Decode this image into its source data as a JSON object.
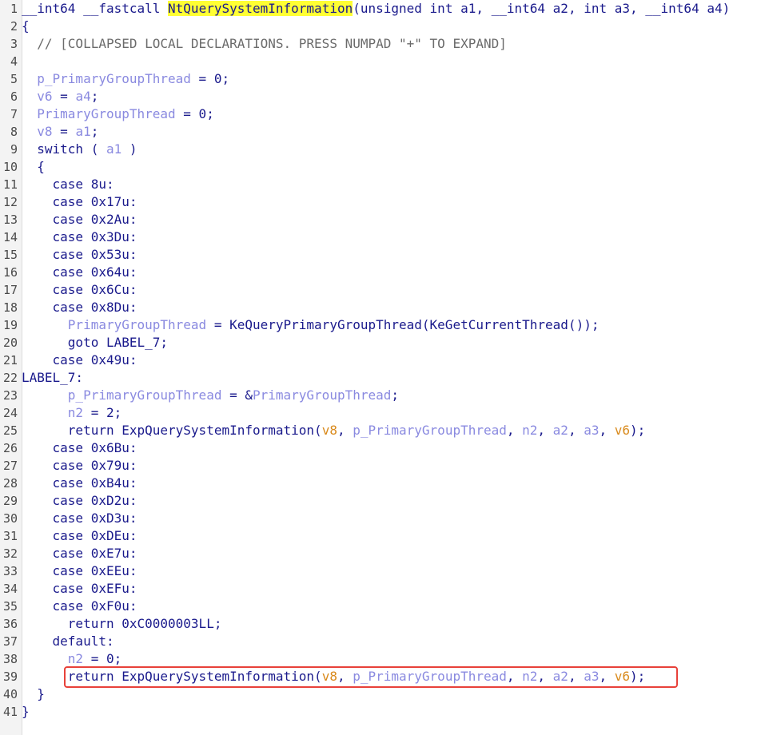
{
  "colors": {
    "background": "#ffffff",
    "gutter": "#f3f3f3",
    "keyword": "#1a1a8c",
    "comment": "#6b6b6b",
    "local_var": "#8a8ae0",
    "argument": "#d98a1c",
    "highlight": "#ffff33",
    "selection_box": "#e8413a"
  },
  "highlighted_line": 39,
  "lines": [
    [
      {
        "t": "__int64 __fastcall ",
        "c": "kw"
      },
      {
        "t": "NtQuerySystemInformation",
        "c": "hl"
      },
      {
        "t": "(unsigned int a1, __int64 a2, int a3, __int64 a4)",
        "c": "kw"
      }
    ],
    [
      {
        "t": "{",
        "c": "pl"
      }
    ],
    [
      {
        "t": "  // [COLLAPSED LOCAL DECLARATIONS. PRESS NUMPAD \"+\" TO EXPAND]",
        "c": "cm"
      }
    ],
    [],
    [
      {
        "t": "  ",
        "c": "pl"
      },
      {
        "t": "p_PrimaryGroupThread",
        "c": "lv"
      },
      {
        "t": " = 0;",
        "c": "pl"
      }
    ],
    [
      {
        "t": "  ",
        "c": "pl"
      },
      {
        "t": "v6",
        "c": "lv"
      },
      {
        "t": " = ",
        "c": "pl"
      },
      {
        "t": "a4",
        "c": "lv"
      },
      {
        "t": ";",
        "c": "pl"
      }
    ],
    [
      {
        "t": "  ",
        "c": "pl"
      },
      {
        "t": "PrimaryGroupThread",
        "c": "lv"
      },
      {
        "t": " = 0;",
        "c": "pl"
      }
    ],
    [
      {
        "t": "  ",
        "c": "pl"
      },
      {
        "t": "v8",
        "c": "lv"
      },
      {
        "t": " = ",
        "c": "pl"
      },
      {
        "t": "a1",
        "c": "lv"
      },
      {
        "t": ";",
        "c": "pl"
      }
    ],
    [
      {
        "t": "  switch ( ",
        "c": "kw"
      },
      {
        "t": "a1",
        "c": "lv"
      },
      {
        "t": " )",
        "c": "pl"
      }
    ],
    [
      {
        "t": "  {",
        "c": "pl"
      }
    ],
    [
      {
        "t": "    case 8u:",
        "c": "kw"
      }
    ],
    [
      {
        "t": "    case 0x17u:",
        "c": "kw"
      }
    ],
    [
      {
        "t": "    case 0x2Au:",
        "c": "kw"
      }
    ],
    [
      {
        "t": "    case 0x3Du:",
        "c": "kw"
      }
    ],
    [
      {
        "t": "    case 0x53u:",
        "c": "kw"
      }
    ],
    [
      {
        "t": "    case 0x64u:",
        "c": "kw"
      }
    ],
    [
      {
        "t": "    case 0x6Cu:",
        "c": "kw"
      }
    ],
    [
      {
        "t": "    case 0x8Du:",
        "c": "kw"
      }
    ],
    [
      {
        "t": "      ",
        "c": "pl"
      },
      {
        "t": "PrimaryGroupThread",
        "c": "lv"
      },
      {
        "t": " = KeQueryPrimaryGroupThread(KeGetCurrentThread());",
        "c": "fn"
      }
    ],
    [
      {
        "t": "      goto LABEL_7;",
        "c": "kw"
      }
    ],
    [
      {
        "t": "    case 0x49u:",
        "c": "kw"
      }
    ],
    [
      {
        "t": "LABEL_7:",
        "c": "kw"
      }
    ],
    [
      {
        "t": "      ",
        "c": "pl"
      },
      {
        "t": "p_PrimaryGroupThread",
        "c": "lv"
      },
      {
        "t": " = &",
        "c": "pl"
      },
      {
        "t": "PrimaryGroupThread",
        "c": "lv"
      },
      {
        "t": ";",
        "c": "pl"
      }
    ],
    [
      {
        "t": "      ",
        "c": "pl"
      },
      {
        "t": "n2",
        "c": "lv"
      },
      {
        "t": " = 2;",
        "c": "pl"
      }
    ],
    [
      {
        "t": "      return ExpQuerySystemInformation(",
        "c": "kw"
      },
      {
        "t": "v8",
        "c": "arg"
      },
      {
        "t": ", ",
        "c": "pl"
      },
      {
        "t": "p_PrimaryGroupThread",
        "c": "lv"
      },
      {
        "t": ", ",
        "c": "pl"
      },
      {
        "t": "n2",
        "c": "lv"
      },
      {
        "t": ", ",
        "c": "pl"
      },
      {
        "t": "a2",
        "c": "lv"
      },
      {
        "t": ", ",
        "c": "pl"
      },
      {
        "t": "a3",
        "c": "lv"
      },
      {
        "t": ", ",
        "c": "pl"
      },
      {
        "t": "v6",
        "c": "arg"
      },
      {
        "t": ");",
        "c": "pl"
      }
    ],
    [
      {
        "t": "    case 0x6Bu:",
        "c": "kw"
      }
    ],
    [
      {
        "t": "    case 0x79u:",
        "c": "kw"
      }
    ],
    [
      {
        "t": "    case 0xB4u:",
        "c": "kw"
      }
    ],
    [
      {
        "t": "    case 0xD2u:",
        "c": "kw"
      }
    ],
    [
      {
        "t": "    case 0xD3u:",
        "c": "kw"
      }
    ],
    [
      {
        "t": "    case 0xDEu:",
        "c": "kw"
      }
    ],
    [
      {
        "t": "    case 0xE7u:",
        "c": "kw"
      }
    ],
    [
      {
        "t": "    case 0xEEu:",
        "c": "kw"
      }
    ],
    [
      {
        "t": "    case 0xEFu:",
        "c": "kw"
      }
    ],
    [
      {
        "t": "    case 0xF0u:",
        "c": "kw"
      }
    ],
    [
      {
        "t": "      return 0xC0000003LL;",
        "c": "kw"
      }
    ],
    [
      {
        "t": "    default:",
        "c": "kw"
      }
    ],
    [
      {
        "t": "      ",
        "c": "pl"
      },
      {
        "t": "n2",
        "c": "lv"
      },
      {
        "t": " = 0;",
        "c": "pl"
      }
    ],
    [
      {
        "t": "      return ExpQuerySystemInformation(",
        "c": "kw"
      },
      {
        "t": "v8",
        "c": "arg"
      },
      {
        "t": ", ",
        "c": "pl"
      },
      {
        "t": "p_PrimaryGroupThread",
        "c": "lv"
      },
      {
        "t": ", ",
        "c": "pl"
      },
      {
        "t": "n2",
        "c": "lv"
      },
      {
        "t": ", ",
        "c": "pl"
      },
      {
        "t": "a2",
        "c": "lv"
      },
      {
        "t": ", ",
        "c": "pl"
      },
      {
        "t": "a3",
        "c": "lv"
      },
      {
        "t": ", ",
        "c": "pl"
      },
      {
        "t": "v6",
        "c": "arg"
      },
      {
        "t": ");",
        "c": "pl"
      }
    ],
    [
      {
        "t": "  }",
        "c": "pl"
      }
    ],
    [
      {
        "t": "}",
        "c": "pl"
      }
    ]
  ]
}
